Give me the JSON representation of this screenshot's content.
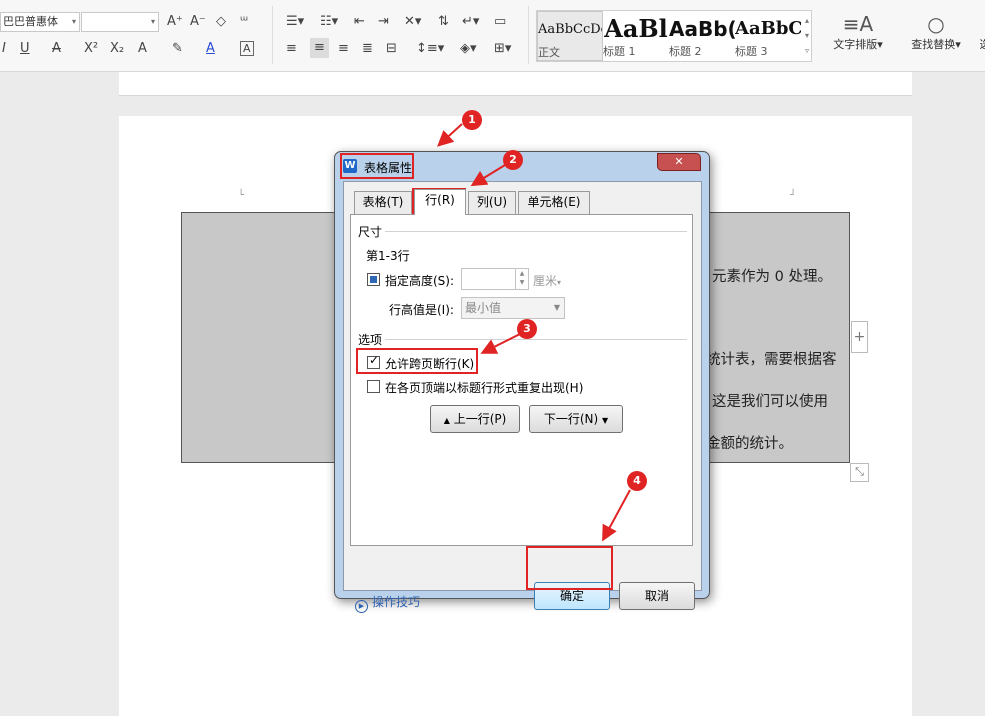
{
  "ribbon": {
    "font_name": "巴巴普惠体",
    "font_size": "",
    "font_size_up": "A⁺",
    "font_size_down": "A⁻",
    "clear_format": "◇",
    "phonetic": "ᵚ",
    "italic": "I",
    "underline": "U",
    "strikethrough": "A",
    "superscript": "X²",
    "subscript": "X₂",
    "text_effect": "A",
    "highlight": "✎",
    "font_color": "A",
    "char_border": "A",
    "styles": [
      {
        "sample": "AaBbCcDc",
        "label": "正文"
      },
      {
        "sample": "AaBl",
        "label": "标题 1"
      },
      {
        "sample": "AaBb(",
        "label": "标题 2"
      },
      {
        "sample": "AaBbC",
        "label": "标题 3"
      }
    ],
    "text_layout": "文字排版",
    "find_replace": "查找替换",
    "select": "选"
  },
  "document": {
    "line1": "元素作为 0 处理。",
    "line2": "统计表，需要根据客",
    "line3": "这是我们可以使用",
    "line4": "金额的统计。"
  },
  "dialog": {
    "title": "表格属性",
    "close": "✕",
    "tabs": [
      {
        "label": "表格(T)"
      },
      {
        "label": "行(R)"
      },
      {
        "label": "列(U)"
      },
      {
        "label": "单元格(E)"
      }
    ],
    "size_group": "尺寸",
    "row_range": "第1-3行",
    "specify_height_label": "指定高度(S):",
    "height_value": "",
    "height_unit": "厘米",
    "row_height_label": "行高值是(I):",
    "row_height_value": "最小值",
    "options_group": "选项",
    "allow_break_label": "允许跨页断行(K)",
    "allow_break_checked": true,
    "repeat_header_label": "在各页顶端以标题行形式重复出现(H)",
    "repeat_header_checked": false,
    "prev_row": "上一行(P)",
    "next_row": "下一行(N)",
    "tips": "操作技巧",
    "ok": "确定",
    "cancel": "取消"
  },
  "callouts": [
    "1",
    "2",
    "3",
    "4"
  ],
  "colors": {
    "accent_red": "#e02424",
    "dialog_frame": "#b9d1ea",
    "table_fill": "#c8c8c8"
  }
}
